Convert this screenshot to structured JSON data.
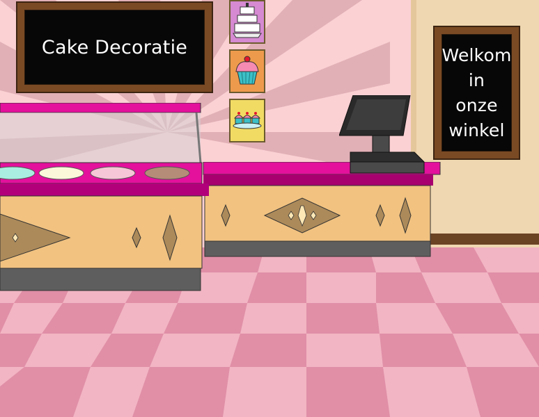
{
  "signs": {
    "title": "Cake Decoratie",
    "welcome_line1": "Welkom",
    "welcome_line2": "in",
    "welcome_line3": "onze",
    "welcome_line4": "winkel"
  },
  "colors": {
    "wall_light": "#fbd1d4",
    "wall_stripe": "#d9a6ac",
    "counter_top": "#e3119c",
    "counter_body": "#f1c280",
    "counter_diamond": "#ac8a5a",
    "floor_light": "#f2b5c3",
    "floor_dark": "#e08fa7",
    "door_wall": "#efd7b1",
    "trim": "#6b4424"
  },
  "posters": [
    {
      "name": "wedding-cake-poster",
      "bg": "#d58ad1"
    },
    {
      "name": "cupcake-poster",
      "bg": "#ee9a4d"
    },
    {
      "name": "cupcakes-plate-poster",
      "bg": "#f2db63"
    }
  ],
  "bowls": [
    {
      "name": "mint-icing-bowl",
      "fill": "#a9eee0"
    },
    {
      "name": "vanilla-icing-bowl",
      "fill": "#fbf7d9"
    },
    {
      "name": "pink-icing-bowl",
      "fill": "#f6c7d6"
    },
    {
      "name": "chocolate-icing-bowl",
      "fill": "#b58c77"
    }
  ]
}
